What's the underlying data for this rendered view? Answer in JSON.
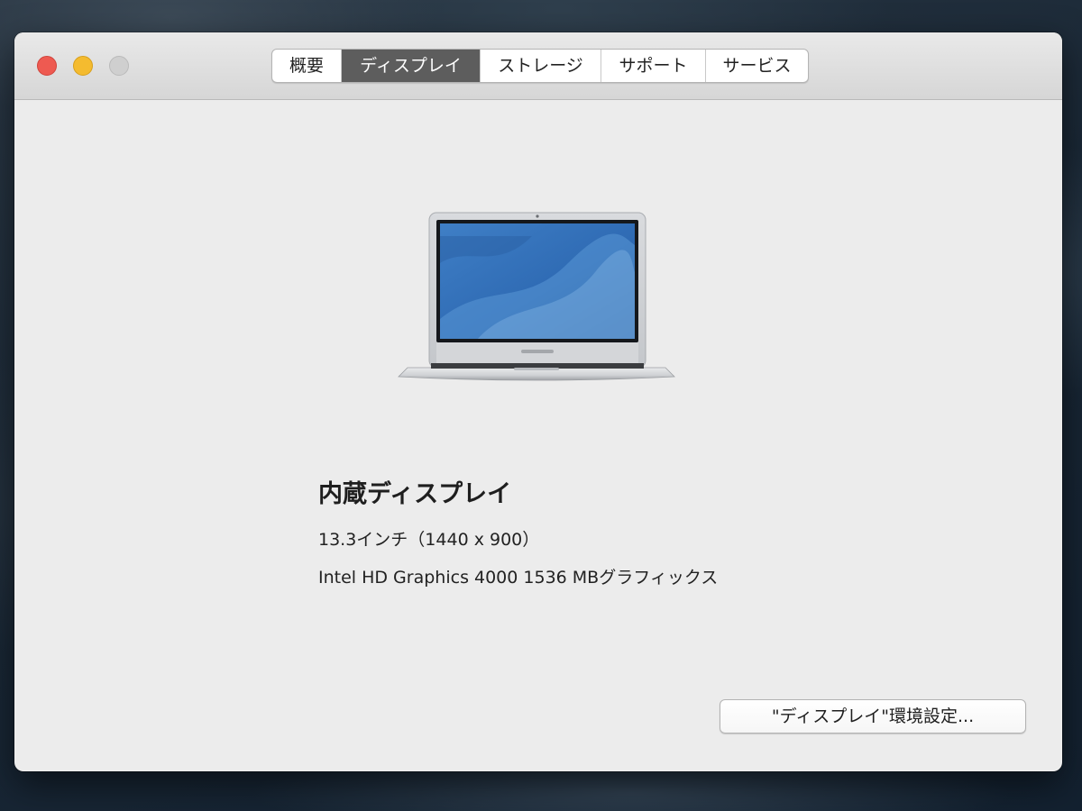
{
  "window": {
    "tabs": [
      {
        "label": "概要",
        "selected": false
      },
      {
        "label": "ディスプレイ",
        "selected": true
      },
      {
        "label": "ストレージ",
        "selected": false
      },
      {
        "label": "サポート",
        "selected": false
      },
      {
        "label": "サービス",
        "selected": false
      }
    ]
  },
  "display": {
    "image": "macbook-air-icon",
    "name": "内蔵ディスプレイ",
    "size_resolution": "13.3インチ（1440 x 900）",
    "graphics": "Intel HD Graphics 4000 1536 MBグラフィックス"
  },
  "button": {
    "label": "\"ディスプレイ\"環境設定..."
  },
  "colors": {
    "active_tab": "#5d5d5d",
    "close_light": "#ee5a51",
    "minimize_light": "#f4bb2f",
    "zoom_light": "#cfcfcf",
    "window_bg": "#ececec"
  }
}
